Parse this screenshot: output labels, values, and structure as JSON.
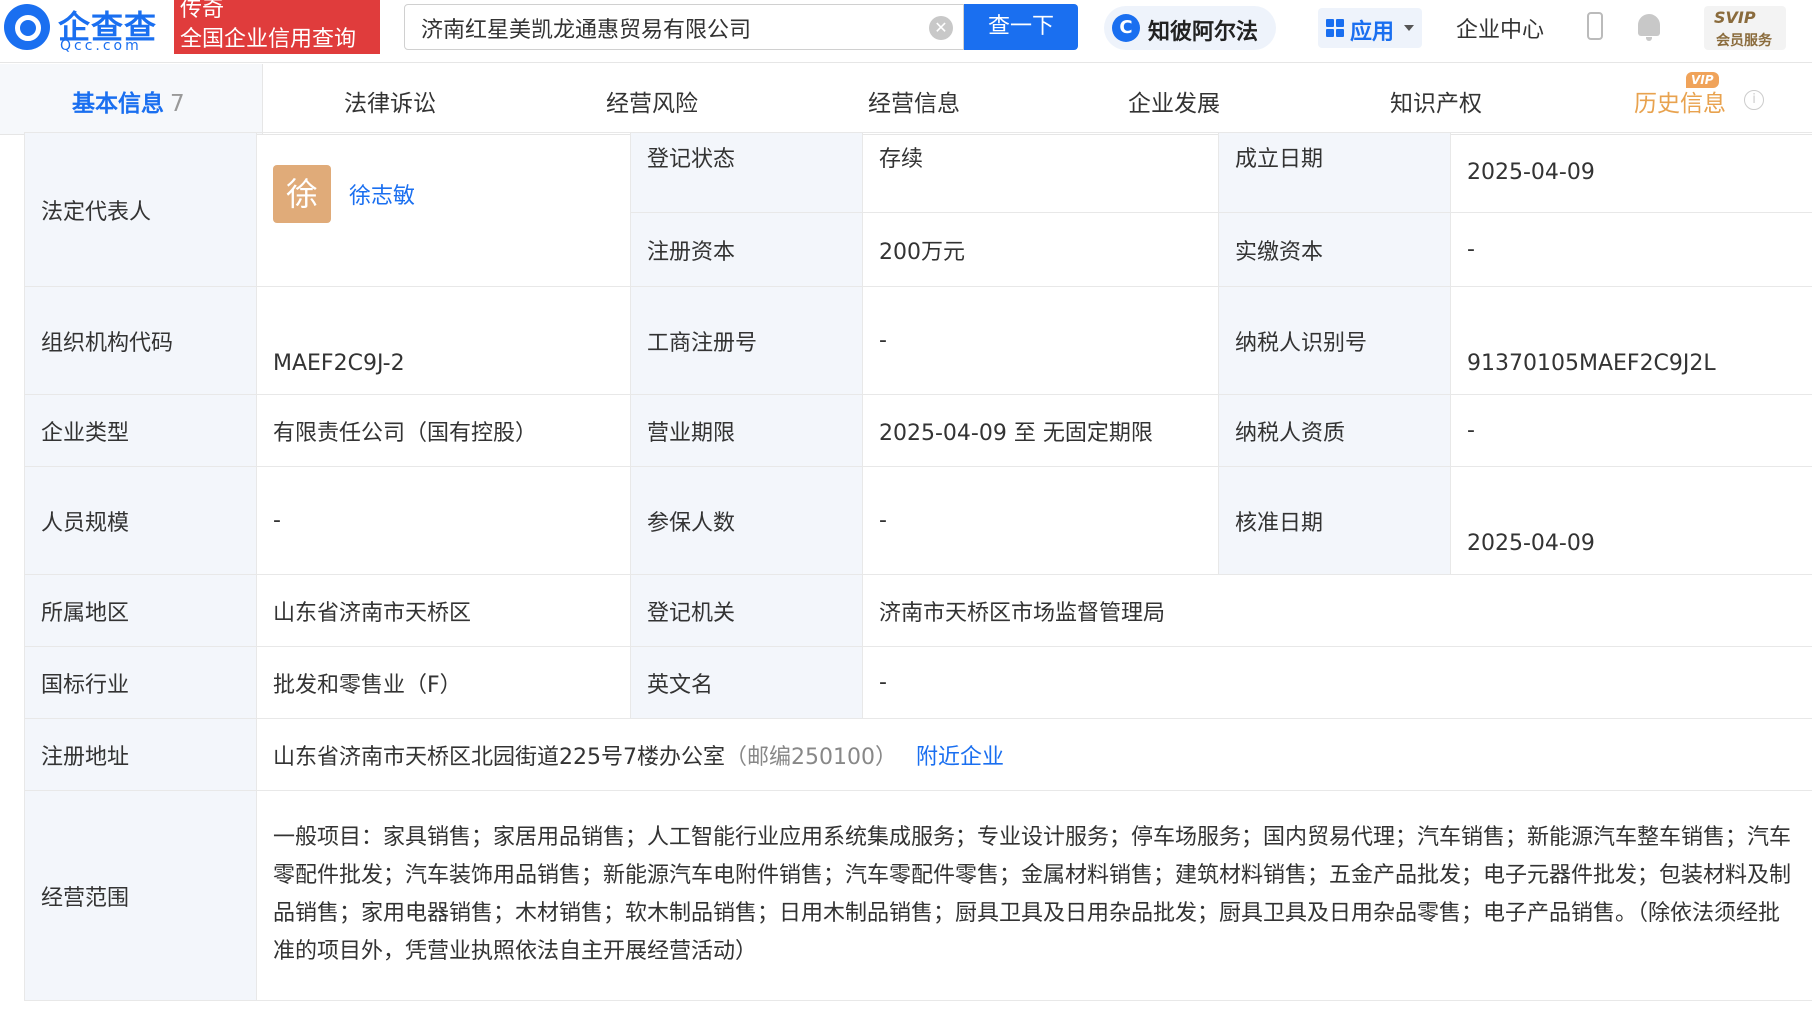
{
  "header": {
    "logo_text": "企查查",
    "logo_sub": "Qcc.com",
    "badge_line1": "传奇",
    "badge_line2": "全国企业信用查询",
    "search_value": "济南红星美凯龙通惠贸易有限公司",
    "search_button": "查一下",
    "ai_label": "知彼阿尔法",
    "apps_label": "应用",
    "enterprise_center": "企业中心",
    "svip_line1": "SVIP",
    "svip_line2": "会员服务"
  },
  "tabs": [
    {
      "label": "基本信息",
      "count": "7"
    },
    {
      "label": "法律诉讼"
    },
    {
      "label": "经营风险"
    },
    {
      "label": "经营信息"
    },
    {
      "label": "企业发展"
    },
    {
      "label": "知识产权"
    },
    {
      "label": "历史信息",
      "tag": "VIP"
    }
  ],
  "company": {
    "legal_rep": {
      "label": "法定代表人",
      "avatar_char": "徐",
      "name": "徐志敏"
    },
    "reg_status": {
      "label": "登记状态",
      "value": "存续"
    },
    "founded": {
      "label": "成立日期",
      "value": "2025-04-09"
    },
    "reg_capital": {
      "label": "注册资本",
      "value": "200万元"
    },
    "paid_capital": {
      "label": "实缴资本",
      "value": "-"
    },
    "org_code": {
      "label": "组织机构代码",
      "value": "MAEF2C9J-2"
    },
    "biz_reg_no": {
      "label": "工商注册号",
      "value": "-"
    },
    "taxpayer_id": {
      "label": "纳税人识别号",
      "value": "91370105MAEF2C9J2L"
    },
    "company_type": {
      "label": "企业类型",
      "value": "有限责任公司（国有控股）"
    },
    "biz_term": {
      "label": "营业期限",
      "value": "2025-04-09 至 无固定期限"
    },
    "taxpayer_qual": {
      "label": "纳税人资质",
      "value": "-"
    },
    "staff_size": {
      "label": "人员规模",
      "value": "-"
    },
    "insured_count": {
      "label": "参保人数",
      "value": "-"
    },
    "approval_date": {
      "label": "核准日期",
      "value": "2025-04-09"
    },
    "region": {
      "label": "所属地区",
      "value": "山东省济南市天桥区"
    },
    "reg_authority": {
      "label": "登记机关",
      "value": "济南市天桥区市场监督管理局"
    },
    "industry": {
      "label": "国标行业",
      "value": "批发和零售业（F）"
    },
    "english_name": {
      "label": "英文名",
      "value": "-"
    },
    "address": {
      "label": "注册地址",
      "value": "山东省济南市天桥区北园街道225号7楼办公室",
      "postcode": "（邮编250100）",
      "nearby_link": "附近企业"
    },
    "scope": {
      "label": "经营范围",
      "value": "一般项目：家具销售；家居用品销售；人工智能行业应用系统集成服务；专业设计服务；停车场服务；国内贸易代理；汽车销售；新能源汽车整车销售；汽车零配件批发；汽车装饰用品销售；新能源汽车电附件销售；汽车零配件零售；金属材料销售；建筑材料销售；五金产品批发；电子元器件批发；包装材料及制品销售；家用电器销售；木材销售；软木制品销售；日用木制品销售；厨具卫具及日用杂品批发；厨具卫具及日用杂品零售；电子产品销售。（除依法须经批准的项目外，凭营业执照依法自主开展经营活动）"
    }
  }
}
